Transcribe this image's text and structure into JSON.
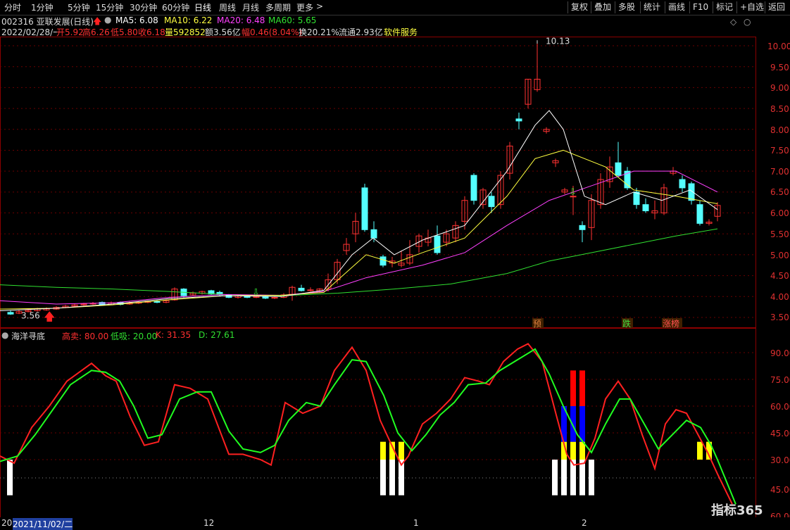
{
  "toolbar": {
    "periods": [
      "分时",
      "1分钟",
      "5分钟",
      "15分钟",
      "30分钟",
      "60分钟",
      "日线",
      "周线",
      "月线",
      "多周期",
      "更多"
    ],
    "more_arrow": ">",
    "right_buttons": [
      "复权",
      "叠加",
      "多股",
      "统计",
      "画线",
      "F10",
      "标记",
      "+自选",
      "返回"
    ]
  },
  "header": {
    "code_name": "002316 亚联发展(日线)",
    "ma5": "MA5: 6.08",
    "ma10": "MA10: 6.22",
    "ma20": "MA20: 6.48",
    "ma60": "MA60: 5.65",
    "line2": {
      "date": "2022/02/28/一",
      "open": "开5.92",
      "high": "高6.26",
      "low": "低5.80",
      "close": "收6.18",
      "vol": "量592852",
      "amount": "额3.56亿",
      "change": "幅0.46(8.04%)",
      "turnover": "换20.21%",
      "float": "流通2.93亿",
      "sector": "软件服务"
    }
  },
  "main_chart": {
    "y_ticks": [
      "10.00",
      "9.50",
      "9.00",
      "8.50",
      "8.00",
      "7.50",
      "7.00",
      "6.50",
      "6.00",
      "5.50",
      "5.00",
      "4.50",
      "4.00",
      "3.50"
    ],
    "high_label": "10.13",
    "low_label": "3.56",
    "signal_labels": [
      {
        "text": "预",
        "color": "#e08040"
      },
      {
        "text": "跌",
        "color": "#40e040"
      },
      {
        "text": "涨榜",
        "color": "#ff5050"
      }
    ]
  },
  "indicator": {
    "name": "海洋寻底",
    "high_sell": "高卖: 80.00",
    "low_buy": "低吸: 20.00",
    "k": "K: 31.35",
    "d": "D: 27.61",
    "y_ticks": [
      "90.00",
      "75.00",
      "60.00",
      "45.00",
      "30.00",
      "45.00",
      "60.00"
    ]
  },
  "x_axis": {
    "start": "2021/11/02/二",
    "labels": [
      "12",
      "1",
      "2"
    ],
    "left_cut": "20"
  },
  "watermark": "指标365",
  "colors": {
    "up": "#ff3232",
    "down": "#54ffff",
    "ma5": "#ffffff",
    "ma10": "#ffff40",
    "ma20": "#ff40ff",
    "ma60": "#30e030",
    "k": "#ff2020",
    "d": "#20ff20"
  }
}
